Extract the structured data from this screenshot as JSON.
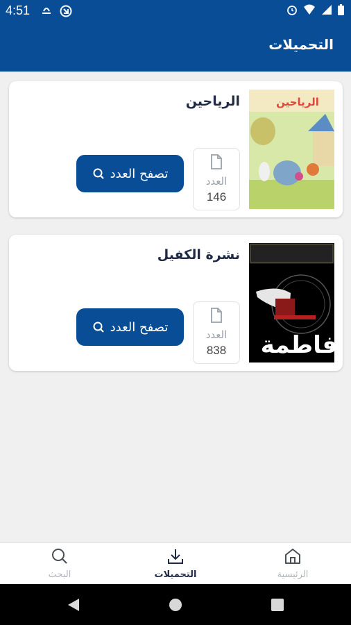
{
  "status_bar": {
    "time": "4:51"
  },
  "app_bar": {
    "title": "التحميلات"
  },
  "cards": [
    {
      "title": "الرياحين",
      "count_label": "العدد",
      "count_value": "146",
      "button_label": "تصفح العدد",
      "cover_logo": "الرياحين"
    },
    {
      "title": "نشرة الكفيل",
      "count_label": "العدد",
      "count_value": "838",
      "button_label": "تصفح العدد",
      "cover_logo": "فاطمة"
    }
  ],
  "bottom_nav": {
    "home": "الرئيسية",
    "downloads": "التحميلات",
    "search": "البحث"
  },
  "colors": {
    "primary": "#0a4d97",
    "background": "#f0f0f0"
  }
}
